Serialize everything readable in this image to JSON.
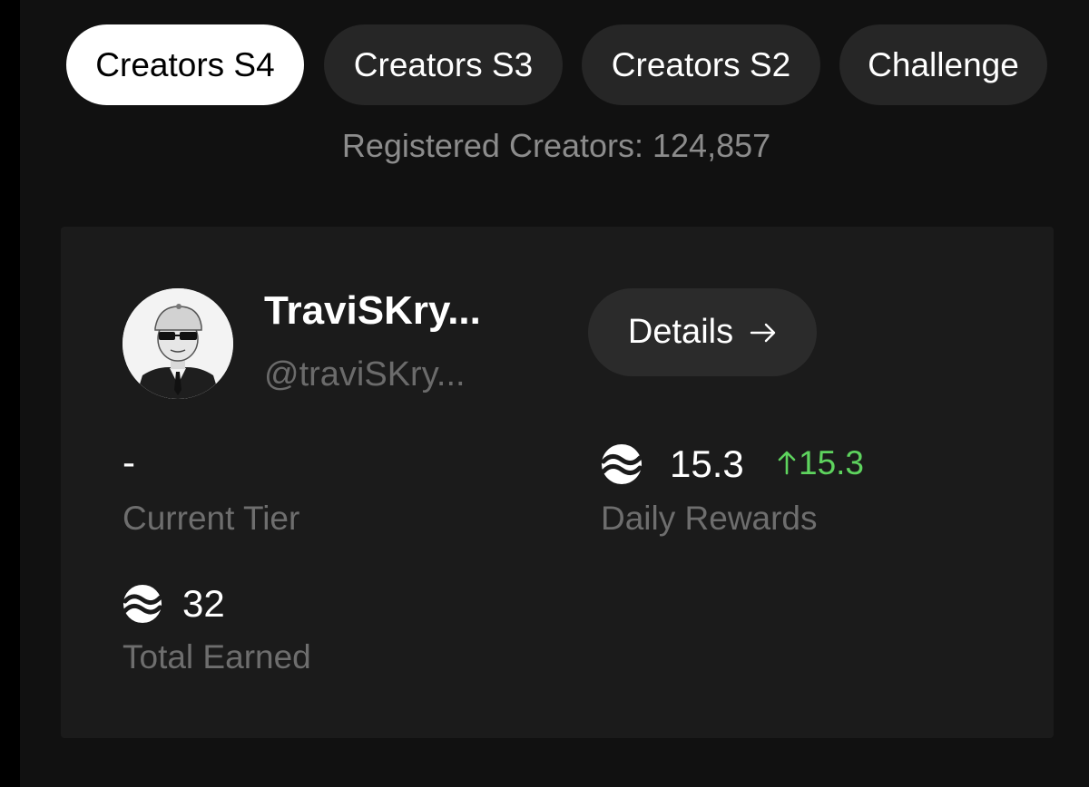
{
  "tabs": [
    {
      "label": "Creators S4",
      "active": true
    },
    {
      "label": "Creators S3",
      "active": false
    },
    {
      "label": "Creators S2",
      "active": false
    },
    {
      "label": "Challenge",
      "active": false
    }
  ],
  "registered": "Registered Creators: 124,857",
  "profile": {
    "name": "TraviSKry...",
    "handle": "@traviSKry...",
    "details_label": "Details",
    "details_icon": "arrow-right-icon"
  },
  "stats": {
    "tier_value": "-",
    "tier_label": "Current Tier",
    "daily_value": "15.3",
    "daily_delta": "15.3",
    "daily_delta_icon": "arrow-up-icon",
    "daily_label": "Daily Rewards",
    "total_value": "32",
    "total_label": "Total Earned",
    "token_icon": "token-coin-icon"
  },
  "colors": {
    "background": "#111111",
    "card": "#1b1b1b",
    "active_tab": "#ffffff",
    "tab": "#262626",
    "positive": "#5ed35e"
  }
}
